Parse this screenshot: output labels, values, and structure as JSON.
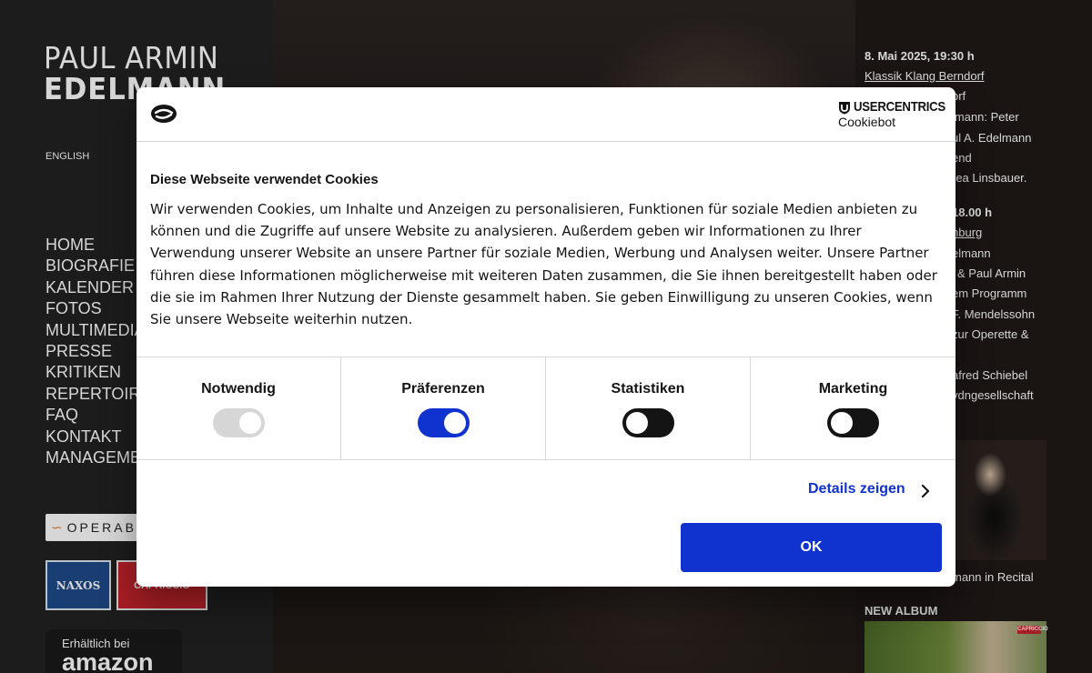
{
  "site": {
    "logo_first": "PAUL ARMIN",
    "logo_last": "EDELMANN",
    "language_link": "ENGLISH",
    "nav": [
      "HOME",
      "BIOGRAFIE",
      "KALENDER",
      "FOTOS",
      "MULTIMEDIA",
      "PRESSE",
      "KRITIKEN",
      "REPERTOIRE",
      "FAQ",
      "KONTAKT",
      "MANAGEMENT"
    ],
    "badges": {
      "operabase": "OPERABASE",
      "naxos": "NAXOS",
      "capriccio": "CAPRICCIO",
      "amazon_small": "Erhältlich bei",
      "amazon_big": "amazon"
    }
  },
  "events": {
    "event1_date": "8. Mai 2025, 19:30 h",
    "event1_link": "Klassik Klang Berndorf",
    "event1_lines": [
      "orf",
      "lmann: Peter",
      "ul A. Edelmann",
      "end",
      "rea Linsbauer."
    ],
    "event2_date": "18.00 h",
    "event2_lines": [
      "nburg",
      "elmann",
      "& Paul Armin",
      "em Programm",
      "F. Mendelssohn",
      "zur Operette &"
    ],
    "event2_tail": [
      "afred Schiebel",
      "ydngesellschaft"
    ],
    "recital_caption": "mann in Recital",
    "new_album_heading": "NEW ALBUM",
    "album_label": "CAPRICCIO"
  },
  "cookie_dialog": {
    "brand_name": "USERCENTRICS",
    "brand_sub": "Cookiebot",
    "title": "Diese Webseite verwendet Cookies",
    "body": "Wir verwenden Cookies, um Inhalte und Anzeigen zu personalisieren, Funktionen für soziale Medien anbieten zu können und die Zugriffe auf unsere Website zu analysieren. Außerdem geben wir Informationen zu Ihrer Verwendung unserer Website an unsere Partner für soziale Medien, Werbung und Analysen weiter. Unsere Partner führen diese Informationen möglicherweise mit weiteren Daten zusammen, die Sie ihnen bereitgestellt haben oder die sie im Rahmen Ihrer Nutzung der Dienste gesammelt haben. Sie geben Einwilligung zu unseren Cookies, wenn Sie unsere Webseite weiterhin nutzen.",
    "categories": [
      {
        "label": "Notwendig",
        "state": "on",
        "disabled": true
      },
      {
        "label": "Präferenzen",
        "state": "on",
        "disabled": false
      },
      {
        "label": "Statistiken",
        "state": "off",
        "disabled": false
      },
      {
        "label": "Marketing",
        "state": "off",
        "disabled": false
      }
    ],
    "details_label": "Details zeigen",
    "ok_label": "OK",
    "accent_color": "#1032cf"
  }
}
